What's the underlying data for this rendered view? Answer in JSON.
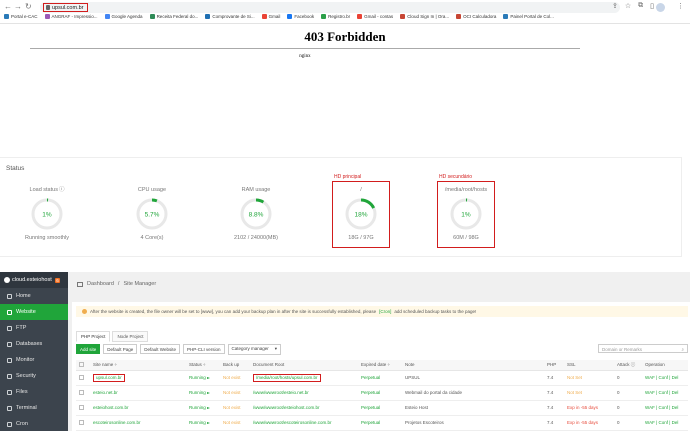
{
  "browser": {
    "url": "upsul.com.br",
    "bookmarks": [
      {
        "label": "Portal e-CAC",
        "color": "#2a7ab8"
      },
      {
        "label": "ANGRAF - Impressio...",
        "color": "#9b59b6"
      },
      {
        "label": "Google Agenda",
        "color": "#4285f4"
      },
      {
        "label": "Receita Federal do...",
        "color": "#2e8b57"
      },
      {
        "label": "Comprovante de Si...",
        "color": "#1f6fb2"
      },
      {
        "label": "Gmail",
        "color": "#ea4335"
      },
      {
        "label": "Facebook",
        "color": "#1877f2"
      },
      {
        "label": "Registro.br",
        "color": "#2b9f48"
      },
      {
        "label": "Gmail - contas",
        "color": "#ea4335"
      },
      {
        "label": "Cloud Sign In | Ora...",
        "color": "#c74634"
      },
      {
        "label": "OCI Calculadora",
        "color": "#c74634"
      },
      {
        "label": "Painel Portal de Col...",
        "color": "#2a7ab8"
      }
    ]
  },
  "error_page": {
    "title": "403 Forbidden",
    "server": "nginx"
  },
  "status": {
    "title": "Status",
    "gauges": [
      {
        "label": "Load status",
        "info": "ⓘ",
        "value": "1%",
        "fraction": 0.01,
        "sub": "Running smoothly",
        "highlight": false,
        "caption": ""
      },
      {
        "label": "CPU usage",
        "info": "",
        "value": "5.7%",
        "fraction": 0.057,
        "sub": "4 Core(s)",
        "highlight": false,
        "caption": ""
      },
      {
        "label": "RAM usage",
        "info": "",
        "value": "8.8%",
        "fraction": 0.088,
        "sub": "2102 / 24000(MB)",
        "highlight": false,
        "caption": ""
      },
      {
        "label": "/",
        "info": "",
        "value": "18%",
        "fraction": 0.18,
        "sub": "18G / 97G",
        "highlight": true,
        "caption": "HD principal"
      },
      {
        "label": "/media/root/hosts",
        "info": "",
        "value": "1%",
        "fraction": 0.01,
        "sub": "60M / 98G",
        "highlight": true,
        "caption": "HD secundário"
      }
    ],
    "accent": "#20a53a"
  },
  "sidebar": {
    "host": "cloud.esteiohost",
    "badge": "6",
    "items": [
      {
        "label": "Home",
        "active": false
      },
      {
        "label": "Website",
        "active": true
      },
      {
        "label": "FTP",
        "active": false
      },
      {
        "label": "Databases",
        "active": false
      },
      {
        "label": "Monitor",
        "active": false
      },
      {
        "label": "Security",
        "active": false
      },
      {
        "label": "Files",
        "active": false
      },
      {
        "label": "Terminal",
        "active": false
      },
      {
        "label": "Cron",
        "active": false
      }
    ]
  },
  "main": {
    "breadcrumb": {
      "home": "Dashboard",
      "sep": "/",
      "current": "Site Manager"
    },
    "notice": {
      "before": "After the website is created, the file owner will be set to [www], you can add your backup plan in after the site is successfully established, please",
      "link": "[Cron]",
      "after": "add scheduled backup tasks to the page!"
    },
    "tabs": [
      "PHP Project",
      "Node Project"
    ],
    "toolbar": {
      "add_site": "Add site",
      "default_page": "Default Page",
      "default_website": "Default Website",
      "php_cli": "PHP-CLI version",
      "category": "Category manager",
      "search_placeholder": "Domain or Remarks"
    },
    "table": {
      "headers": [
        "Site name ÷",
        "Status ÷",
        "Back up",
        "Document Root",
        "Expired date ÷",
        "Note",
        "PHP",
        "SSL",
        "Attack ⓘ",
        "Operation"
      ],
      "rows": [
        {
          "site": "upsul.com.br",
          "status": "Running",
          "backup": "Not exist",
          "root": "/media/root/hosts/upsul.com.br",
          "expired": "Perpetual",
          "note": "UPSUL",
          "php": "7.4",
          "ssl": "Not Set",
          "ssl_class": "orange",
          "attack": "0",
          "ops": "WAF | Conf | Del",
          "highlight": true
        },
        {
          "site": "esteio.net.br",
          "status": "Running",
          "backup": "Not exist",
          "root": "/www/wwwroot/esteio.net.br",
          "expired": "Perpetual",
          "note": "Webmail do portal da cidade",
          "php": "7.4",
          "ssl": "Not Set",
          "ssl_class": "orange",
          "attack": "0",
          "ops": "WAF | Conf | Del",
          "highlight": false
        },
        {
          "site": "esteiohost.com.br",
          "status": "Running",
          "backup": "Not exist",
          "root": "/www/wwwroot/esteiohost.com.br",
          "expired": "Perpetual",
          "note": "Esteio Host",
          "php": "7.4",
          "ssl": "Exp in -55 days",
          "ssl_class": "red",
          "attack": "0",
          "ops": "WAF | Conf | Del",
          "highlight": false
        },
        {
          "site": "escoteirosonline.com.br",
          "status": "Running",
          "backup": "Not exist",
          "root": "/www/wwwroot/escoteirosonline.com.br",
          "expired": "Perpetual",
          "note": "Projetos Escoteiros",
          "php": "7.4",
          "ssl": "Exp in -55 days",
          "ssl_class": "red",
          "attack": "0",
          "ops": "WAF | Conf | Del",
          "highlight": false
        }
      ]
    }
  }
}
